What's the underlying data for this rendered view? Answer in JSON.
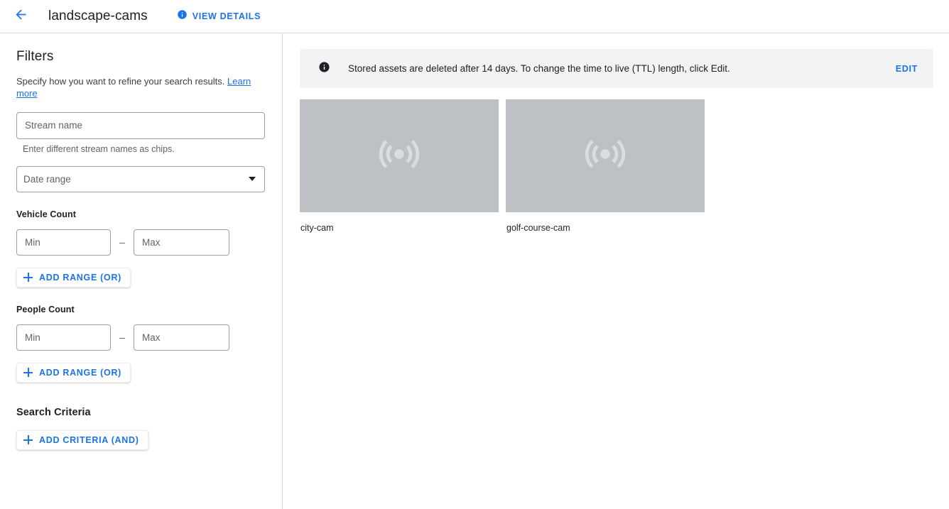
{
  "appbar": {
    "back_icon": "arrow-back-icon",
    "title": "landscape-cams",
    "view_details_label": "VIEW DETAILS",
    "info_icon": "info-filled-icon"
  },
  "colors": {
    "accent_blue": "#1a73e8",
    "banner_bg": "#f1f3f4",
    "card_bg": "#bdc1c6",
    "border_grey": "#dadce0",
    "field_border": "#9aa0a6",
    "text_primary": "#202124",
    "text_secondary": "#5f6368"
  },
  "sidebar": {
    "title": "Filters",
    "subtitle": "Specify how you want to refine your search results.",
    "learn_more_label": "Learn more",
    "stream_name": {
      "label": "Stream name",
      "placeholder": "Stream name",
      "value": "",
      "helper": "Enter different stream names as chips."
    },
    "date_range": {
      "label": "Date range",
      "selected": "Date range",
      "caret_icon": "chevron-down-icon"
    },
    "vehicle_count": {
      "label": "Vehicle Count",
      "min_placeholder": "Min",
      "min_value": "",
      "max_placeholder": "Max",
      "max_value": "",
      "separator": "–",
      "add_range_label": "ADD RANGE (OR)",
      "plus_icon": "plus-icon"
    },
    "people_count": {
      "label": "People Count",
      "min_placeholder": "Min",
      "min_value": "",
      "max_placeholder": "Max",
      "max_value": "",
      "separator": "–",
      "add_range_label": "ADD RANGE (OR)",
      "plus_icon": "plus-icon"
    },
    "search_criteria": {
      "label": "Search Criteria",
      "add_criteria_label": "ADD CRITERIA (AND)",
      "plus_icon": "plus-icon"
    }
  },
  "main": {
    "banner": {
      "icon": "info-filled-icon",
      "text": "Stored assets are deleted after 14 days. To change the time to live (TTL) length, click Edit.",
      "action_label": "EDIT"
    },
    "streams": [
      {
        "name": "city-cam",
        "thumb_icon": "live-stream-icon"
      },
      {
        "name": "golf-course-cam",
        "thumb_icon": "live-stream-icon"
      }
    ]
  }
}
